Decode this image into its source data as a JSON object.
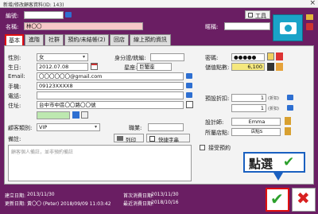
{
  "window": {
    "title": "新增/修改顧客資料(ID: 143)",
    "close": "×"
  },
  "header": {
    "member_no_label": "編號:",
    "name_label": "名稱:",
    "name_value": "林〇〇",
    "nickname_label": "暱稱:",
    "tools_button": "工具"
  },
  "tabs": [
    "基本",
    "進階",
    "社群",
    "預約/未結帳(2)",
    "回店",
    "線上預約資訊"
  ],
  "basic": {
    "gender_label": "性別:",
    "gender_value": "女",
    "id_label": "身分證/統編:",
    "birthday_label": "生日:",
    "birthday_value": "2012.07.08",
    "zodiac_label": "星座:",
    "zodiac_value": "巨蟹座",
    "email_label": "Email:",
    "email_value": "〇〇〇〇〇〇@gmail.com",
    "mobile_label": "手機:",
    "mobile_value": "09123XXXX8",
    "phone_label": "電話:",
    "address_label": "住址:",
    "address_value": "台中市中區〇〇路〇〇號",
    "customer_type_label": "顧客類別:",
    "customer_type_value": "VIP",
    "job_label": "職業:",
    "notes_label": "備註:",
    "print_button": "列印",
    "quick_text_button": "快捷字串",
    "notes_placeholder": "顧客個人備註，並非預約備註"
  },
  "right": {
    "password_label": "密碼:",
    "password_value": "●●●●●",
    "balance_label": "儲值點數:",
    "balance_value": "6,100",
    "pre_discount_label": "預設折扣:",
    "pre_discount_value": "1",
    "pre_discount_unit": "(折扣)",
    "discount2_value": "1",
    "discount2_unit": "(折扣)",
    "designer_label": "設計師:",
    "designer_value": "Emma",
    "store_label": "所屬店點:",
    "store_value": "店點S",
    "accept_booking_label": "接受預約"
  },
  "annotation": {
    "text": "點選"
  },
  "footer": {
    "created_label": "建立日期:",
    "created_value": "2013/11/30",
    "modified_label": "更新日期:",
    "modified_value": "黃〇〇 (Peter) 2018/09/09 11:03:42",
    "first_visit_label": "首次消費日期:",
    "first_visit_value": "2013/11/30",
    "last_visit_label": "最近消費日期:",
    "last_visit_value": "2018/10/16"
  }
}
